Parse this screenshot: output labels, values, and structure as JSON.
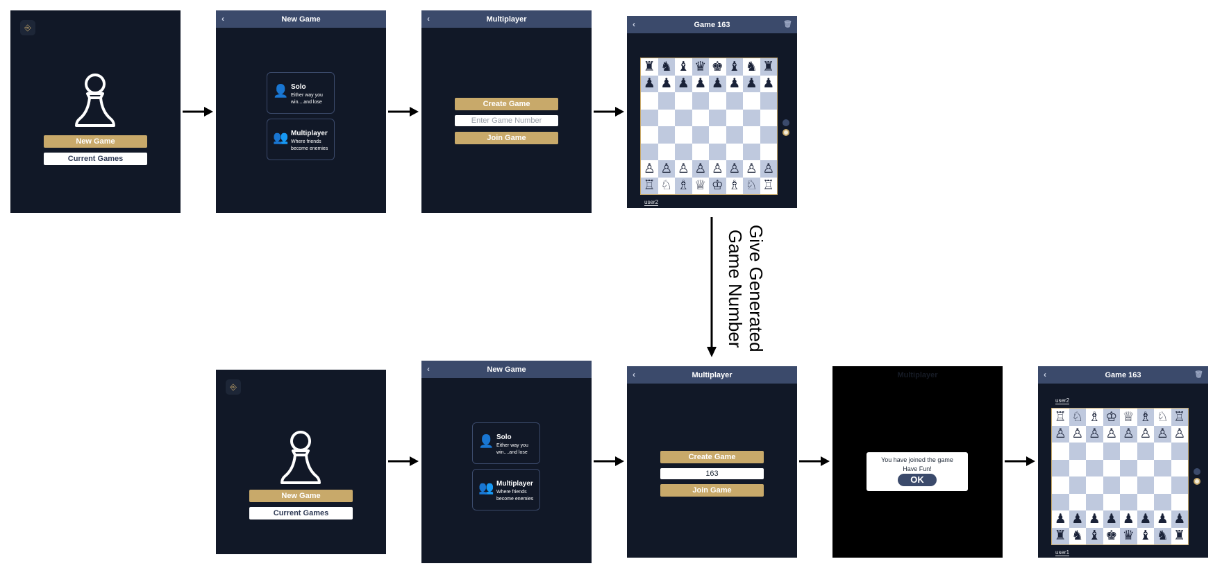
{
  "colors": {
    "background": "#111827",
    "topbar": "#3b4a6b",
    "gold": "#c8a96a",
    "light_square": "#ffffff",
    "dark_square": "#bfc9de"
  },
  "icons": {
    "logout": "logout-icon",
    "back": "chevron-left-icon",
    "trash": "trash-icon",
    "solo": "user-icon",
    "multiplayer": "users-icon",
    "pawn": "pawn-icon"
  },
  "labels": {
    "new_game": "New Game",
    "current_games": "Current Games",
    "new_game_title": "New Game",
    "multiplayer_title": "Multiplayer",
    "solo_title": "Solo",
    "solo_desc": "Either way you win....and lose",
    "multi_title": "Multiplayer",
    "multi_desc": "Where friends become enemies",
    "create_game": "Create Game",
    "join_game": "Join Game",
    "enter_placeholder": "Enter Game Number",
    "entered_number": "163",
    "game_title": "Game 163",
    "user1": "user1",
    "user2": "user2",
    "joined_line1": "You have joined the game",
    "joined_line2": "Have Fun!",
    "ok": "OK",
    "dim_title": "Multiplayer",
    "back": "‹",
    "trash": "🗑",
    "logout": "⎆"
  },
  "transition_label": "Give Generated Game Number",
  "boards": {
    "white_view": {
      "rank8": [
        "♜",
        "♞",
        "♝",
        "♛",
        "♚",
        "♝",
        "♞",
        "♜"
      ],
      "rank7": [
        "♟",
        "♟",
        "♟",
        "♟",
        "♟",
        "♟",
        "♟",
        "♟"
      ],
      "rank2": [
        "♙",
        "♙",
        "♙",
        "♙",
        "♙",
        "♙",
        "♙",
        "♙"
      ],
      "rank1": [
        "♖",
        "♘",
        "♗",
        "♕",
        "♔",
        "♗",
        "♘",
        "♖"
      ]
    },
    "black_view": {
      "top1": [
        "♖",
        "♘",
        "♗",
        "♔",
        "♕",
        "♗",
        "♘",
        "♖"
      ],
      "top2": [
        "♙",
        "♙",
        "♙",
        "♙",
        "♙",
        "♙",
        "♙",
        "♙"
      ],
      "bot2": [
        "♟",
        "♟",
        "♟",
        "♟",
        "♟",
        "♟",
        "♟",
        "♟"
      ],
      "bot1": [
        "♜",
        "♞",
        "♝",
        "♚",
        "♛",
        "♝",
        "♞",
        "♜"
      ]
    }
  }
}
